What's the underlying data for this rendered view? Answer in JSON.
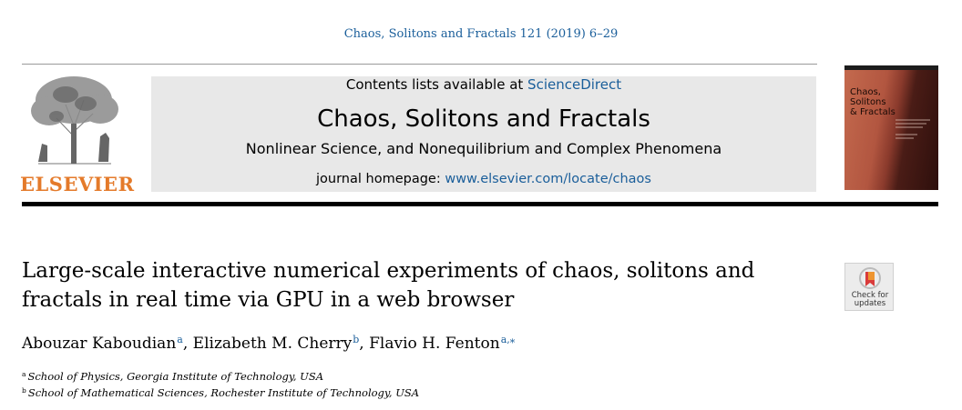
{
  "citation": "Chaos, Solitons and Fractals 121 (2019) 6–29",
  "publisher": {
    "name": "ELSEVIER",
    "logo_icon": "elsevier-tree-icon"
  },
  "masthead": {
    "contents_prefix": "Contents lists available at ",
    "contents_link": "ScienceDirect",
    "journal_title": "Chaos, Solitons and Fractals",
    "journal_subtitle": "Nonlinear Science, and Nonequilibrium and Complex Phenomena",
    "homepage_prefix": "journal homepage: ",
    "homepage_link": "www.elsevier.com/locate/chaos"
  },
  "cover": {
    "title_lines": [
      "Chaos,",
      "Solitons",
      "& Fractals"
    ]
  },
  "article": {
    "title": "Large-scale interactive numerical experiments of chaos, solitons and fractals in real time via GPU in a web browser",
    "authors": [
      {
        "name": "Abouzar Kaboudian",
        "marks": "a",
        "separator": ", "
      },
      {
        "name": "Elizabeth M. Cherry",
        "marks": "b",
        "separator": ", "
      },
      {
        "name": "Flavio H. Fenton",
        "marks": "a,⁎",
        "separator": ""
      }
    ],
    "affiliations": [
      {
        "mark": "a",
        "text": "School of Physics, Georgia Institute of Technology, USA"
      },
      {
        "mark": "b",
        "text": "School of Mathematical Sciences, Rochester Institute of Technology, USA"
      }
    ]
  },
  "check_for_updates": {
    "label_line1": "Check for",
    "label_line2": "updates"
  },
  "colors": {
    "link": "#1a5e9a",
    "publisher_orange": "#e47a2a",
    "masthead_bg": "#e8e8e8"
  }
}
